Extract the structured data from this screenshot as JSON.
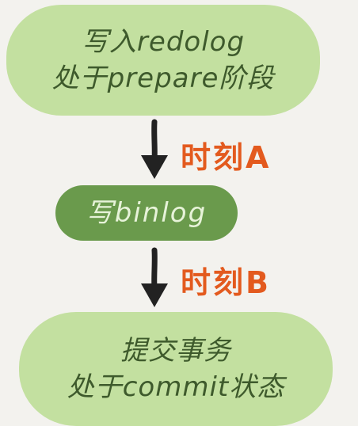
{
  "flow": {
    "step1": {
      "line1": "写入redolog",
      "line2": "处于prepare阶段"
    },
    "step2": {
      "line1": "写binlog"
    },
    "step3": {
      "line1": "提交事务",
      "line2": "处于commit状态"
    },
    "moment_a": "时刻A",
    "moment_b": "时刻B"
  },
  "colors": {
    "background": "#f3f2ee",
    "light_node": "#c3e0a0",
    "dark_node": "#6a9a4c",
    "arrow": "#222222",
    "label": "#e35a1e"
  },
  "icons": {
    "arrow1": "arrow-down-icon",
    "arrow2": "arrow-down-icon"
  }
}
